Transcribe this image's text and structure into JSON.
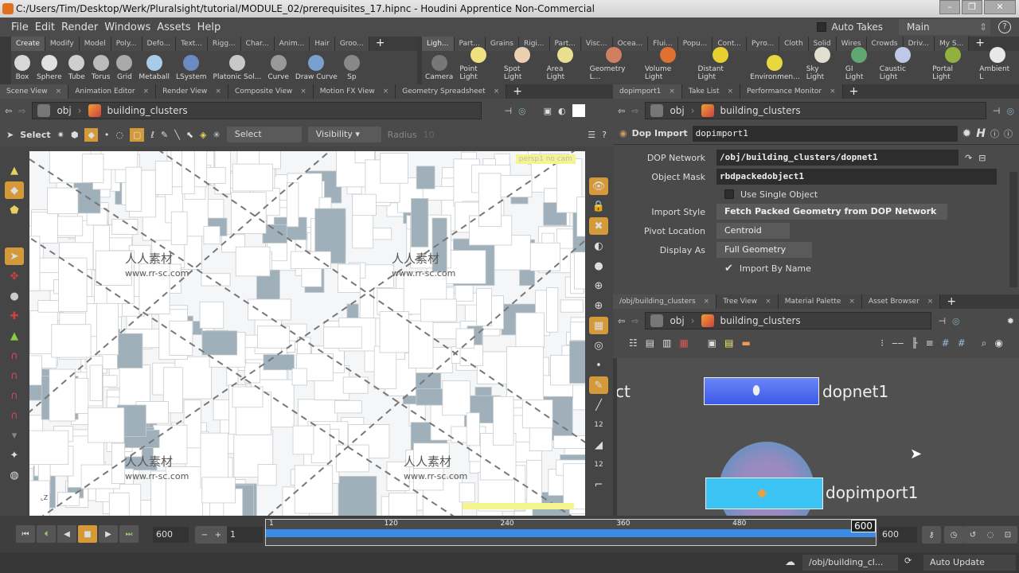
{
  "window": {
    "title": "C:/Users/Tim/Desktop/Werk/Pluralsight/tutorial/MODULE_02/prerequisites_17.hipnc - Houdini Apprentice Non-Commercial",
    "buttons": [
      "minimize",
      "maximize",
      "close"
    ]
  },
  "menu": {
    "items": [
      "File",
      "Edit",
      "Render",
      "Windows",
      "Assets",
      "Help"
    ],
    "auto_takes_label": "Auto Takes",
    "take_selector": "Main"
  },
  "shelf_left": {
    "tabs": [
      "Create",
      "Modify",
      "Model",
      "Poly...",
      "Defo...",
      "Text...",
      "Rigg...",
      "Char...",
      "Anim...",
      "Hair",
      "Groo..."
    ],
    "tools": [
      {
        "label": "Box",
        "color": "#d8d8d8"
      },
      {
        "label": "Sphere",
        "color": "#e0e0e0"
      },
      {
        "label": "Tube",
        "color": "#cfcfcf"
      },
      {
        "label": "Torus",
        "color": "#bbbbbb"
      },
      {
        "label": "Grid",
        "color": "#aaaaaa"
      },
      {
        "label": "Metaball",
        "color": "#a8cbe8"
      },
      {
        "label": "LSystem",
        "color": "#6a8cc0"
      },
      {
        "label": "Platonic Sol...",
        "color": "#c8c8c8"
      },
      {
        "label": "Curve",
        "color": "#999999"
      },
      {
        "label": "Draw Curve",
        "color": "#7aa0d0"
      },
      {
        "label": "Sp",
        "color": "#888888"
      }
    ]
  },
  "shelf_right": {
    "tabs": [
      "Ligh...",
      "Part...",
      "Grains",
      "Rigi...",
      "Part...",
      "Visc...",
      "Ocea...",
      "Flui...",
      "Popu...",
      "Cont...",
      "Pyro...",
      "Cloth",
      "Solid",
      "Wires",
      "Crowds",
      "Driv...",
      "My S..."
    ],
    "tools": [
      {
        "label": "Camera",
        "color": "#777777"
      },
      {
        "label": "Point Light",
        "color": "#f0e080"
      },
      {
        "label": "Spot Light",
        "color": "#e8d0b0"
      },
      {
        "label": "Area Light",
        "color": "#e8e090"
      },
      {
        "label": "Geometry L...",
        "color": "#d08060"
      },
      {
        "label": "Volume Light",
        "color": "#e07030"
      },
      {
        "label": "Distant Light",
        "color": "#e8d030"
      },
      {
        "label": "Environmen...",
        "color": "#e8d840"
      },
      {
        "label": "Sky Light",
        "color": "#e0e0d0"
      },
      {
        "label": "GI Light",
        "color": "#60a870"
      },
      {
        "label": "Caustic Light",
        "color": "#c0c8e8"
      },
      {
        "label": "Portal Light",
        "color": "#90b040"
      },
      {
        "label": "Ambient L",
        "color": "#e8e8e8"
      }
    ]
  },
  "scene_pane": {
    "tabs": [
      "Scene View",
      "Animation Editor",
      "Render View",
      "Composite View",
      "Motion FX View",
      "Geometry Spreadsheet"
    ],
    "path": [
      "obj",
      "building_clusters"
    ],
    "toolbar": {
      "select_label": "Select",
      "select_mode": "Select",
      "visibility": "Visibility",
      "radius_label": "Radius",
      "radius_value": "10"
    },
    "viewport": {
      "camera_label": "persp1",
      "cam_menu": "no cam",
      "axis": "Z",
      "watermark": "人人素材",
      "watermark_url": "www.rr-sc.com"
    }
  },
  "params_pane": {
    "tabs": [
      "dopimport1",
      "Take List",
      "Performance Monitor"
    ],
    "path": [
      "obj",
      "building_clusters"
    ],
    "node_type": "Dop Import",
    "node_name": "dopimport1",
    "parms": {
      "dop_network_label": "DOP Network",
      "dop_network": "/obj/building_clusters/dopnet1",
      "object_mask_label": "Object Mask",
      "object_mask": "rbdpackedobject1",
      "use_single_label": "Use Single Object",
      "use_single": false,
      "import_style_label": "Import Style",
      "import_style": "Fetch Packed Geometry from DOP Network",
      "pivot_label": "Pivot Location",
      "pivot": "Centroid",
      "display_as_label": "Display As",
      "display_as": "Full Geometry",
      "import_by_name_label": "Import By Name",
      "import_by_name": true
    }
  },
  "network_pane": {
    "tabs": [
      "/obj/building_clusters",
      "Tree View",
      "Material Palette",
      "Asset Browser"
    ],
    "path": [
      "obj",
      "building_clusters"
    ],
    "nodes": [
      {
        "name": "dopnet1",
        "color": "#4a6cf0"
      },
      {
        "name": "dopimport1",
        "color": "#3cc4f4"
      }
    ],
    "partial_label": "ct"
  },
  "timeline": {
    "end_frame_field": "600",
    "current_frame": "1",
    "ticks": [
      "1",
      "120",
      "240",
      "360",
      "480"
    ],
    "range_end": "600",
    "end_field": "600",
    "start": 1,
    "end": 600,
    "current": 1
  },
  "status": {
    "path": "/obj/building_cl...",
    "update_mode": "Auto Update"
  }
}
